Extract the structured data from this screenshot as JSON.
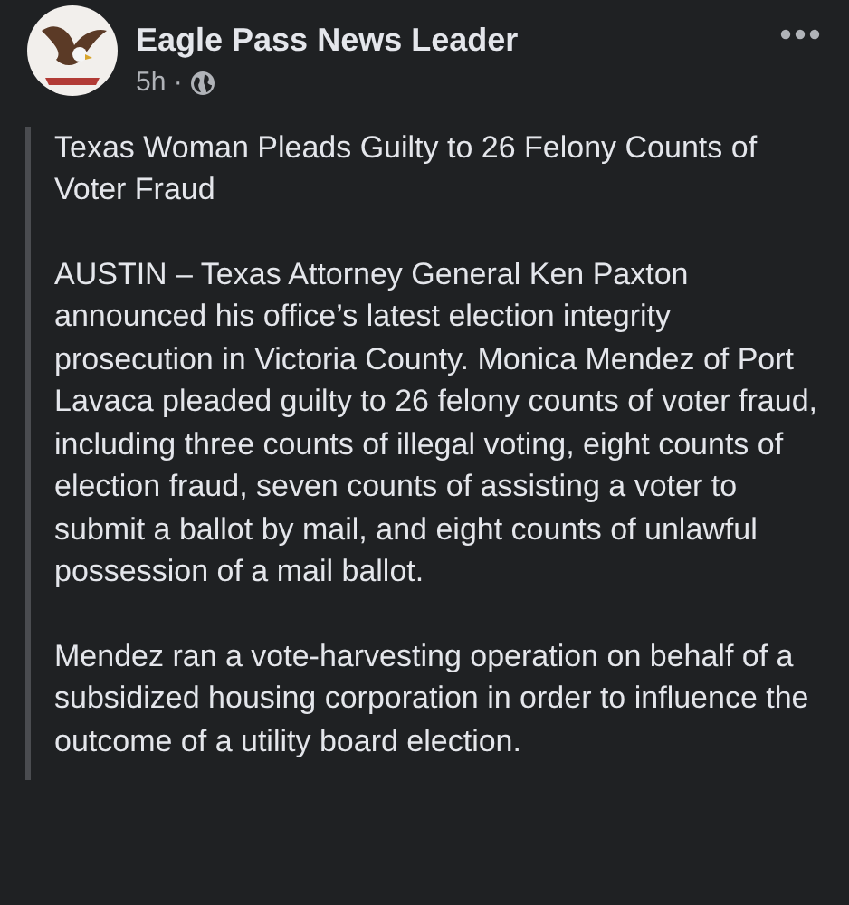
{
  "post": {
    "author": "Eagle Pass News Leader",
    "time": "5h ·",
    "paragraphs": [
      "Texas Woman Pleads Guilty to 26 Felony Counts of Voter Fraud",
      "AUSTIN – Texas Attorney General Ken Paxton announced his office’s latest election integrity prosecution in Victoria County. Monica Mendez of Port Lavaca pleaded guilty to 26 felony counts of voter fraud, including three counts of illegal voting, eight counts of election fraud, seven counts of assisting a voter to submit a ballot by mail, and eight counts of unlawful possession of a mail ballot.",
      "Mendez ran a vote-harvesting operation on behalf of a subsidized housing corporation in order to influence the outcome of a utility board election."
    ]
  }
}
